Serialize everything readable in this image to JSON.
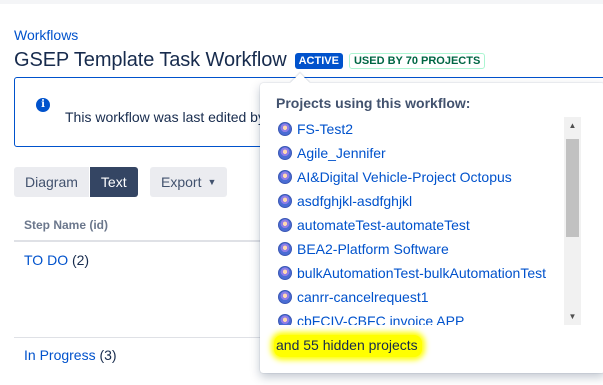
{
  "breadcrumb": "Workflows",
  "header": {
    "title": "GSEP Template Task Workflow",
    "status_lozenge": "ACTIVE",
    "usage_lozenge": "USED BY 70 PROJECTS"
  },
  "info": {
    "text": "This workflow was last edited by"
  },
  "view_toggle": {
    "diagram_label": "Diagram",
    "text_label": "Text",
    "selected": "Text"
  },
  "export_label": "Export",
  "table": {
    "column_header": "Step Name (id)",
    "rows": [
      {
        "name": "TO DO",
        "id": "(2)"
      },
      {
        "name": "In Progress",
        "id": "(3)"
      }
    ]
  },
  "popup": {
    "title": "Projects using this workflow:",
    "projects": [
      "FS-Test2",
      "Agile_Jennifer",
      "AI&Digital Vehicle-Project Octopus",
      "asdfghjkl-asdfghjkl",
      "automateTest-automateTest",
      "BEA2-Platform Software",
      "bulkAutomationTest-bulkAutomationTest",
      "canrr-cancelrequest1",
      "cbFCIV-CBFC invoice APP"
    ],
    "hidden_note": "and 55 hidden projects"
  },
  "icons": {
    "info": "info-icon",
    "project": "project-avatar-icon",
    "export_chevron": "chevron-down-icon"
  },
  "colors": {
    "link": "#0052cc",
    "active_lozenge": "#0052cc",
    "used_lozenge_text": "#006644",
    "selected_button": "#344563",
    "highlight": "#ffff00"
  }
}
